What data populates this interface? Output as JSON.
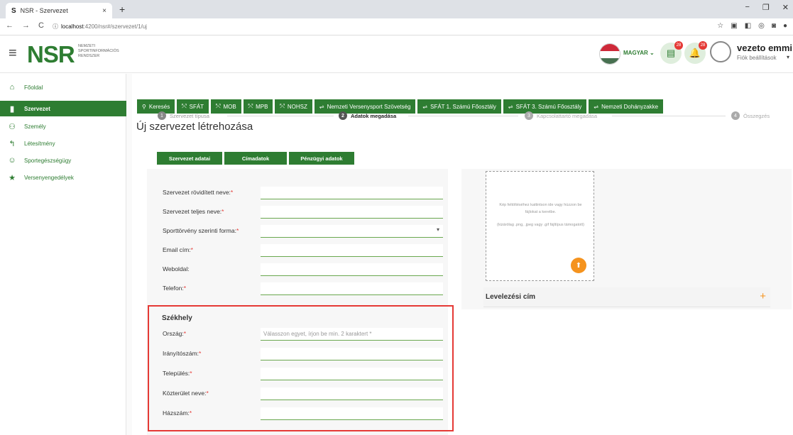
{
  "browser": {
    "tab_title": "NSR - Szervezet",
    "tab_favicon": "S",
    "tab_close": "×",
    "new_tab": "+",
    "url_host": "localhost",
    "url_path": ":4200/nsr#/szervezet/1/uj",
    "window_controls": [
      "−",
      "❐",
      "✕"
    ]
  },
  "header": {
    "logo": "NSR",
    "logo_sub_lines": [
      "NEMZETI",
      "SPORTINFORMÁCIÓS",
      "RENDSZER"
    ],
    "language": "MAGYAR ⌄",
    "badge_1": "28",
    "badge_2": "28",
    "user_name": "vezeto emmi",
    "user_sub": "Fiók beállítások",
    "flag_colors": [
      "#ce2939",
      "#ffffff",
      "#477050"
    ]
  },
  "sidebar": {
    "items": [
      {
        "label": "Főoldal",
        "icon": "home-icon",
        "glyph": "🏠"
      },
      {
        "label": "Szervezet",
        "icon": "building-icon",
        "glyph": "▮"
      },
      {
        "label": "Személy",
        "icon": "people-icon",
        "glyph": "👥"
      },
      {
        "label": "Létesítmény",
        "icon": "facility-icon",
        "glyph": "⛭"
      },
      {
        "label": "Sportegészségügy",
        "icon": "smile-icon",
        "glyph": "☺"
      },
      {
        "label": "Versenyengedélyek",
        "icon": "star-icon",
        "glyph": "★"
      }
    ],
    "active_index": 1
  },
  "quick_tabs": [
    {
      "label": "Keresés",
      "glyph": "🔍"
    },
    {
      "label": "SFÁT",
      "glyph": "⤲"
    },
    {
      "label": "MOB",
      "glyph": "⤲"
    },
    {
      "label": "MPB",
      "glyph": "⤲"
    },
    {
      "label": "NOHSZ",
      "glyph": "⤲"
    },
    {
      "label": "Nemzeti Versenysport Szövetség",
      "glyph": "⇌"
    },
    {
      "label": "SFÁT 1. Számú Főosztály",
      "glyph": "⇌"
    },
    {
      "label": "SFÁT 3. Számú Főosztály",
      "glyph": "⇌"
    },
    {
      "label": "Nemzeti Dohányzakke",
      "glyph": "⇌"
    }
  ],
  "page_title": "Új szervezet létrehozása",
  "steps": [
    {
      "num": "1",
      "label": "Szervezet típusa",
      "state": "done"
    },
    {
      "num": "2",
      "label": "Adatok megadása",
      "state": "active"
    },
    {
      "num": "3",
      "label": "Kapcsolattartó megadása",
      "state": "todo"
    },
    {
      "num": "4",
      "label": "Összegzés",
      "state": "todo"
    }
  ],
  "form_tabs": [
    "Szervezet adatai",
    "Címadatok",
    "Pénzügyi adatok"
  ],
  "form_fields": [
    {
      "label": "Szervezet rövidített neve:",
      "required": true,
      "value": "",
      "placeholder": ""
    },
    {
      "label": "Szervezet teljes neve:",
      "required": true,
      "value": "",
      "placeholder": ""
    },
    {
      "label": "Sporttörvény szerinti forma:",
      "required": true,
      "value": "",
      "placeholder": "",
      "dropdown": true
    },
    {
      "label": "Email cím:",
      "required": true,
      "value": "",
      "placeholder": ""
    },
    {
      "label": "Weboldal:",
      "required": false,
      "value": "",
      "placeholder": ""
    },
    {
      "label": "Telefon:",
      "required": true,
      "value": "",
      "placeholder": ""
    }
  ],
  "szekhely": {
    "title": "Székhely",
    "fields": [
      {
        "label": "Ország:",
        "required": true,
        "placeholder": "Válasszon egyet, írjon be min. 2 karaktert *"
      },
      {
        "label": "Irányítószám:",
        "required": true,
        "placeholder": ""
      },
      {
        "label": "Település:",
        "required": true,
        "placeholder": ""
      },
      {
        "label": "Közterület neve:",
        "required": true,
        "placeholder": ""
      },
      {
        "label": "Házszám:",
        "required": true,
        "placeholder": ""
      }
    ]
  },
  "upload": {
    "line1": "Kép feltöltéséhez kattintson ide vagy húzzon be fájlokat a keretbe.",
    "line2": "(kizárólag .png, .jpeg vagy .gif fájltípus támogatott)"
  },
  "levelezesi": {
    "title": "Levelezési cím",
    "plus": "+"
  },
  "colors": {
    "brand_green": "#2e7d32",
    "accent_orange": "#f5931e",
    "highlight_red": "#e53935"
  }
}
